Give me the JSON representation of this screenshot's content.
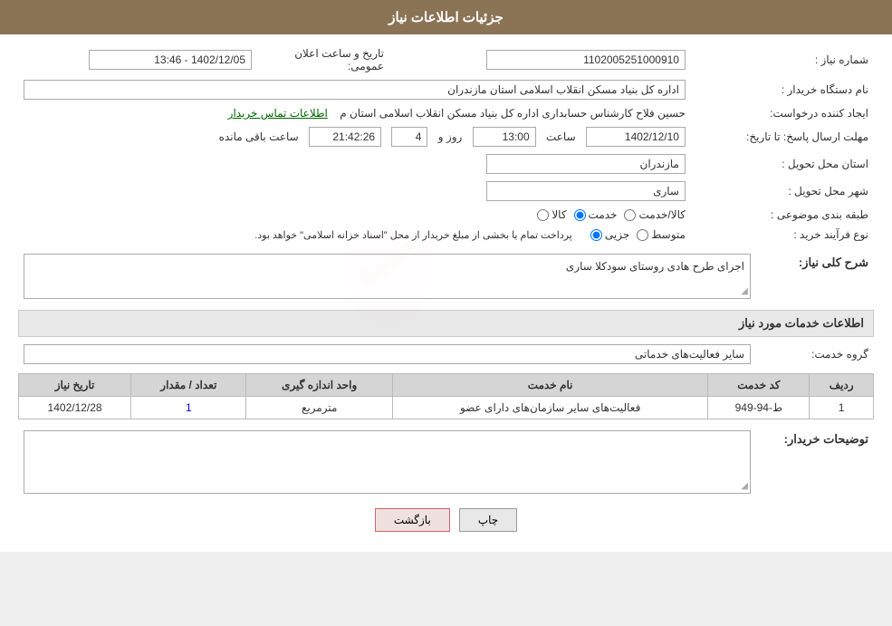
{
  "header": {
    "title": "جزئیات اطلاعات نیاز"
  },
  "fields": {
    "need_number_label": "شماره نیاز :",
    "need_number_value": "1102005251000910",
    "buyer_org_label": "نام دستگاه خریدار :",
    "buyer_org_value": "اداره کل بنیاد مسکن انقلاب اسلامی استان مازندران",
    "creator_label": "ایجاد کننده درخواست:",
    "creator_value": "حسین فلاح کارشناس حسابداری اداره کل بنیاد مسکن انقلاب اسلامی استان م",
    "creator_link": "اطلاعات تماس خریدار",
    "send_date_label": "مهلت ارسال پاسخ: تا تاریخ:",
    "date_value": "1402/12/10",
    "time_label": "ساعت",
    "time_value": "13:00",
    "days_label": "روز و",
    "days_value": "4",
    "remaining_label": "ساعت باقی مانده",
    "remaining_time": "21:42:26",
    "announce_label": "تاریخ و ساعت اعلان عمومی:",
    "announce_value": "1402/12/05 - 13:46",
    "province_label": "استان محل تحویل :",
    "province_value": "مازندران",
    "city_label": "شهر محل تحویل :",
    "city_value": "ساری",
    "category_label": "طبقه بندی موضوعی :",
    "category_options": [
      {
        "id": "kala",
        "label": "کالا"
      },
      {
        "id": "khadamat",
        "label": "خدمت"
      },
      {
        "id": "kala_khadamat",
        "label": "کالا/خدمت"
      }
    ],
    "category_selected": "khadamat",
    "purchase_type_label": "نوع فرآیند خرید :",
    "purchase_options": [
      {
        "id": "jozei",
        "label": "جزیی"
      },
      {
        "id": "motavasset",
        "label": "متوسط"
      }
    ],
    "purchase_selected": "jozei",
    "purchase_note": "پرداخت تمام یا بخشی از مبلغ خریدار از محل \"اسناد خزانه اسلامی\" خواهد بود."
  },
  "description_section": {
    "title": "شرح کلی نیاز:",
    "value": "اجرای طرح هادی روستای سودکلا ساری"
  },
  "services_section": {
    "title": "اطلاعات خدمات مورد نیاز",
    "service_group_label": "گروه خدمت:",
    "service_group_value": "سایر فعالیت‌های خدماتی",
    "table": {
      "columns": [
        "ردیف",
        "کد خدمت",
        "نام خدمت",
        "واحد اندازه گیری",
        "تعداد / مقدار",
        "تاریخ نیاز"
      ],
      "rows": [
        {
          "row_num": "1",
          "service_code": "ط-94-949",
          "service_name": "فعالیت‌های سایر سازمان‌های دارای عضو",
          "unit": "مترمربع",
          "quantity": "1",
          "date": "1402/12/28"
        }
      ]
    }
  },
  "buyer_description": {
    "title": "توضیحات خریدار:",
    "value": ""
  },
  "buttons": {
    "print": "چاپ",
    "back": "بازگشت"
  }
}
